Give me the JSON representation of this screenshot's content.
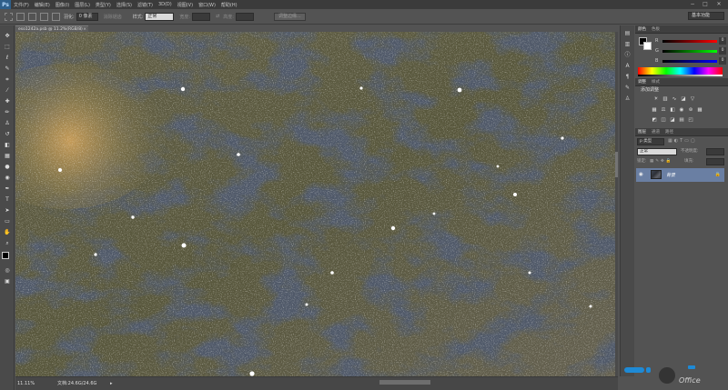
{
  "app": {
    "logo": "Ps"
  },
  "menubar": {
    "items": [
      "文件(F)",
      "编辑(E)",
      "图像(I)",
      "图层(L)",
      "类型(Y)",
      "选择(S)",
      "滤镜(T)",
      "3D(D)",
      "视图(V)",
      "窗口(W)",
      "帮助(H)"
    ],
    "window_controls": [
      "−",
      "□",
      "✕"
    ]
  },
  "options_bar": {
    "feather_label": "羽化:",
    "feather_value": "0 像素",
    "antialias_label": "消除锯齿",
    "style_label": "样式:",
    "style_value": "正常",
    "width_label": "宽度:",
    "height_label": "高度:",
    "refine_edge_label": "调整边缘...",
    "workspace_value": "基本功能"
  },
  "document": {
    "tab_title": "eso1242a.psb @ 11.2%(RGB/8)",
    "tab_close": "×",
    "zoom": "11.11%",
    "doc_info": "文档:24.6G/24.6G",
    "status_arrow": "▸"
  },
  "right_panel": {
    "color_tabs": [
      "颜色",
      "色板"
    ],
    "color_sliders": [
      {
        "label": "R",
        "value": "0"
      },
      {
        "label": "G",
        "value": "0"
      },
      {
        "label": "B",
        "value": "0"
      }
    ],
    "adjust_tabs": [
      "调整",
      "样式"
    ],
    "adjust_title": "添加调整",
    "layers_tabs": [
      "图层",
      "通道",
      "路径"
    ],
    "layers_kind": "p 类型",
    "blend_mode": "正常",
    "opacity_label": "不透明度:",
    "lock_label": "锁定:",
    "fill_label": "填充:",
    "layer_name": "背景"
  },
  "watermark": {
    "text": "Office"
  },
  "colors": {
    "accent_blue": "#1e8ad6",
    "selected_layer": "#6a7fa3"
  }
}
